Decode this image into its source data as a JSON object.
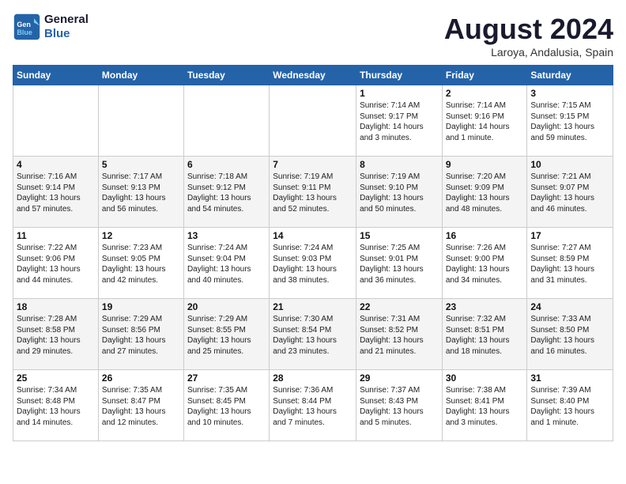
{
  "header": {
    "logo_general": "General",
    "logo_blue": "Blue",
    "title": "August 2024",
    "subtitle": "Laroya, Andalusia, Spain"
  },
  "weekdays": [
    "Sunday",
    "Monday",
    "Tuesday",
    "Wednesday",
    "Thursday",
    "Friday",
    "Saturday"
  ],
  "weeks": [
    [
      {
        "day": "",
        "info": ""
      },
      {
        "day": "",
        "info": ""
      },
      {
        "day": "",
        "info": ""
      },
      {
        "day": "",
        "info": ""
      },
      {
        "day": "1",
        "info": "Sunrise: 7:14 AM\nSunset: 9:17 PM\nDaylight: 14 hours\nand 3 minutes."
      },
      {
        "day": "2",
        "info": "Sunrise: 7:14 AM\nSunset: 9:16 PM\nDaylight: 14 hours\nand 1 minute."
      },
      {
        "day": "3",
        "info": "Sunrise: 7:15 AM\nSunset: 9:15 PM\nDaylight: 13 hours\nand 59 minutes."
      }
    ],
    [
      {
        "day": "4",
        "info": "Sunrise: 7:16 AM\nSunset: 9:14 PM\nDaylight: 13 hours\nand 57 minutes."
      },
      {
        "day": "5",
        "info": "Sunrise: 7:17 AM\nSunset: 9:13 PM\nDaylight: 13 hours\nand 56 minutes."
      },
      {
        "day": "6",
        "info": "Sunrise: 7:18 AM\nSunset: 9:12 PM\nDaylight: 13 hours\nand 54 minutes."
      },
      {
        "day": "7",
        "info": "Sunrise: 7:19 AM\nSunset: 9:11 PM\nDaylight: 13 hours\nand 52 minutes."
      },
      {
        "day": "8",
        "info": "Sunrise: 7:19 AM\nSunset: 9:10 PM\nDaylight: 13 hours\nand 50 minutes."
      },
      {
        "day": "9",
        "info": "Sunrise: 7:20 AM\nSunset: 9:09 PM\nDaylight: 13 hours\nand 48 minutes."
      },
      {
        "day": "10",
        "info": "Sunrise: 7:21 AM\nSunset: 9:07 PM\nDaylight: 13 hours\nand 46 minutes."
      }
    ],
    [
      {
        "day": "11",
        "info": "Sunrise: 7:22 AM\nSunset: 9:06 PM\nDaylight: 13 hours\nand 44 minutes."
      },
      {
        "day": "12",
        "info": "Sunrise: 7:23 AM\nSunset: 9:05 PM\nDaylight: 13 hours\nand 42 minutes."
      },
      {
        "day": "13",
        "info": "Sunrise: 7:24 AM\nSunset: 9:04 PM\nDaylight: 13 hours\nand 40 minutes."
      },
      {
        "day": "14",
        "info": "Sunrise: 7:24 AM\nSunset: 9:03 PM\nDaylight: 13 hours\nand 38 minutes."
      },
      {
        "day": "15",
        "info": "Sunrise: 7:25 AM\nSunset: 9:01 PM\nDaylight: 13 hours\nand 36 minutes."
      },
      {
        "day": "16",
        "info": "Sunrise: 7:26 AM\nSunset: 9:00 PM\nDaylight: 13 hours\nand 34 minutes."
      },
      {
        "day": "17",
        "info": "Sunrise: 7:27 AM\nSunset: 8:59 PM\nDaylight: 13 hours\nand 31 minutes."
      }
    ],
    [
      {
        "day": "18",
        "info": "Sunrise: 7:28 AM\nSunset: 8:58 PM\nDaylight: 13 hours\nand 29 minutes."
      },
      {
        "day": "19",
        "info": "Sunrise: 7:29 AM\nSunset: 8:56 PM\nDaylight: 13 hours\nand 27 minutes."
      },
      {
        "day": "20",
        "info": "Sunrise: 7:29 AM\nSunset: 8:55 PM\nDaylight: 13 hours\nand 25 minutes."
      },
      {
        "day": "21",
        "info": "Sunrise: 7:30 AM\nSunset: 8:54 PM\nDaylight: 13 hours\nand 23 minutes."
      },
      {
        "day": "22",
        "info": "Sunrise: 7:31 AM\nSunset: 8:52 PM\nDaylight: 13 hours\nand 21 minutes."
      },
      {
        "day": "23",
        "info": "Sunrise: 7:32 AM\nSunset: 8:51 PM\nDaylight: 13 hours\nand 18 minutes."
      },
      {
        "day": "24",
        "info": "Sunrise: 7:33 AM\nSunset: 8:50 PM\nDaylight: 13 hours\nand 16 minutes."
      }
    ],
    [
      {
        "day": "25",
        "info": "Sunrise: 7:34 AM\nSunset: 8:48 PM\nDaylight: 13 hours\nand 14 minutes."
      },
      {
        "day": "26",
        "info": "Sunrise: 7:35 AM\nSunset: 8:47 PM\nDaylight: 13 hours\nand 12 minutes."
      },
      {
        "day": "27",
        "info": "Sunrise: 7:35 AM\nSunset: 8:45 PM\nDaylight: 13 hours\nand 10 minutes."
      },
      {
        "day": "28",
        "info": "Sunrise: 7:36 AM\nSunset: 8:44 PM\nDaylight: 13 hours\nand 7 minutes."
      },
      {
        "day": "29",
        "info": "Sunrise: 7:37 AM\nSunset: 8:43 PM\nDaylight: 13 hours\nand 5 minutes."
      },
      {
        "day": "30",
        "info": "Sunrise: 7:38 AM\nSunset: 8:41 PM\nDaylight: 13 hours\nand 3 minutes."
      },
      {
        "day": "31",
        "info": "Sunrise: 7:39 AM\nSunset: 8:40 PM\nDaylight: 13 hours\nand 1 minute."
      }
    ]
  ]
}
